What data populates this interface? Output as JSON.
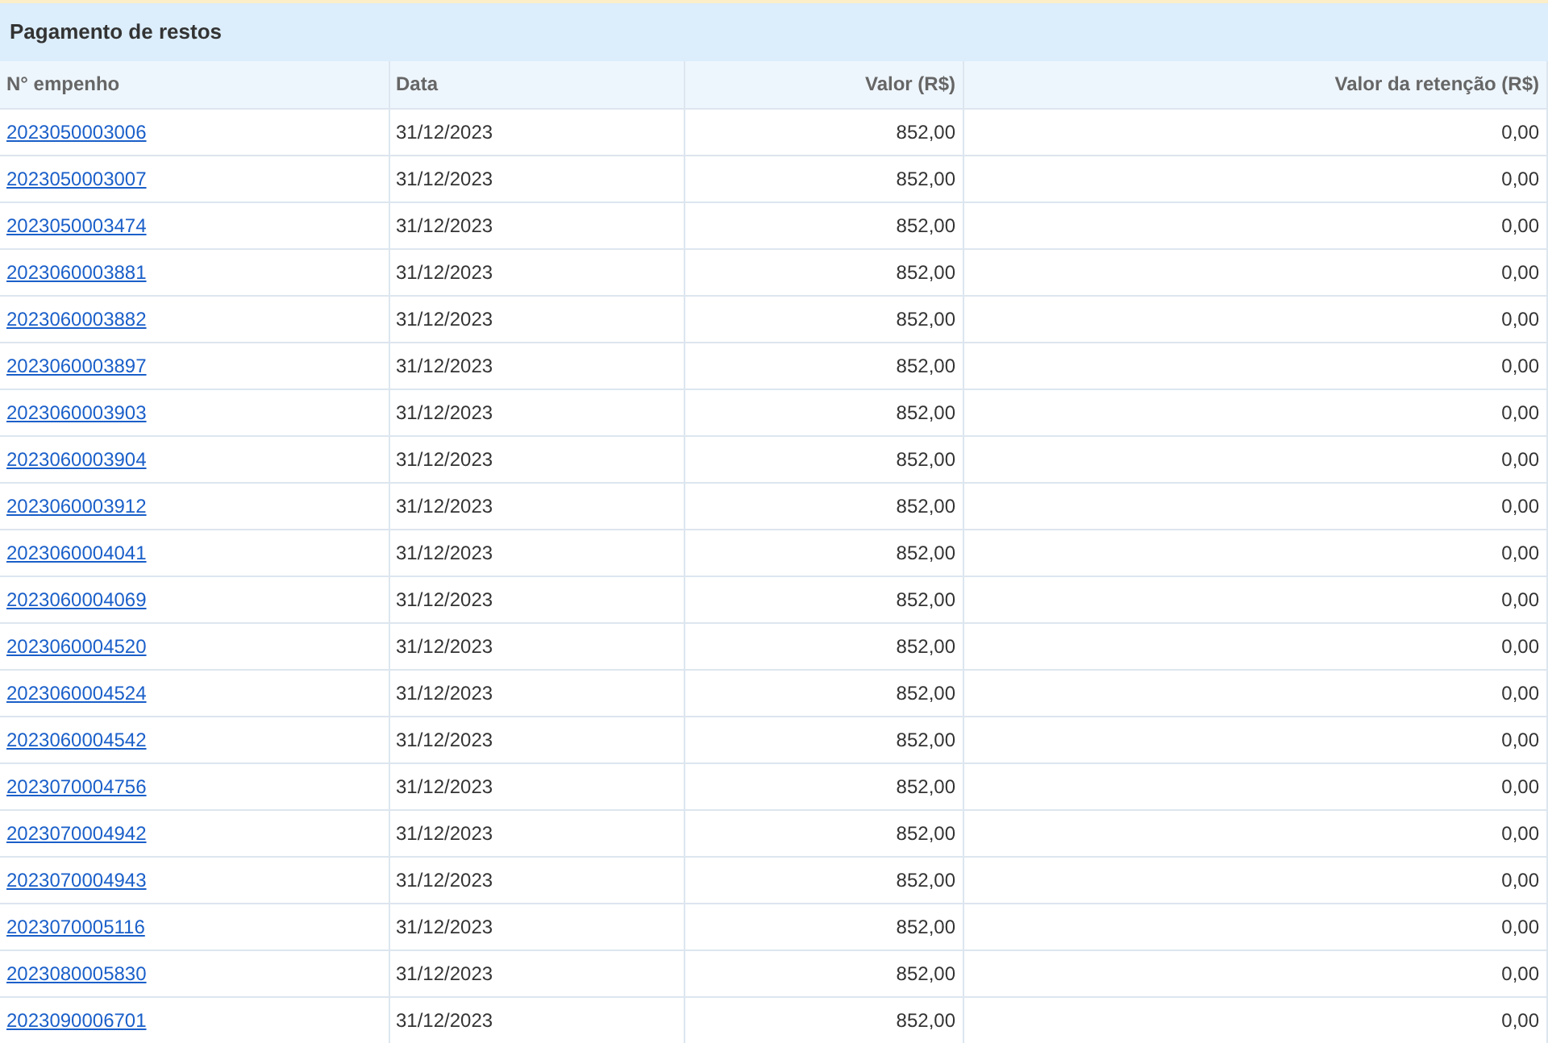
{
  "panel": {
    "title": "Pagamento de restos"
  },
  "table": {
    "columns": [
      "N° empenho",
      "Data",
      "Valor (R$)",
      "Valor da retenção (R$)"
    ],
    "rows": [
      [
        "2023050003006",
        "31/12/2023",
        "852,00",
        "0,00"
      ],
      [
        "2023050003007",
        "31/12/2023",
        "852,00",
        "0,00"
      ],
      [
        "2023050003474",
        "31/12/2023",
        "852,00",
        "0,00"
      ],
      [
        "2023060003881",
        "31/12/2023",
        "852,00",
        "0,00"
      ],
      [
        "2023060003882",
        "31/12/2023",
        "852,00",
        "0,00"
      ],
      [
        "2023060003897",
        "31/12/2023",
        "852,00",
        "0,00"
      ],
      [
        "2023060003903",
        "31/12/2023",
        "852,00",
        "0,00"
      ],
      [
        "2023060003904",
        "31/12/2023",
        "852,00",
        "0,00"
      ],
      [
        "2023060003912",
        "31/12/2023",
        "852,00",
        "0,00"
      ],
      [
        "2023060004041",
        "31/12/2023",
        "852,00",
        "0,00"
      ],
      [
        "2023060004069",
        "31/12/2023",
        "852,00",
        "0,00"
      ],
      [
        "2023060004520",
        "31/12/2023",
        "852,00",
        "0,00"
      ],
      [
        "2023060004524",
        "31/12/2023",
        "852,00",
        "0,00"
      ],
      [
        "2023060004542",
        "31/12/2023",
        "852,00",
        "0,00"
      ],
      [
        "2023070004756",
        "31/12/2023",
        "852,00",
        "0,00"
      ],
      [
        "2023070004942",
        "31/12/2023",
        "852,00",
        "0,00"
      ],
      [
        "2023070004943",
        "31/12/2023",
        "852,00",
        "0,00"
      ],
      [
        "2023070005116",
        "31/12/2023",
        "852,00",
        "0,00"
      ],
      [
        "2023080005830",
        "31/12/2023",
        "852,00",
        "0,00"
      ],
      [
        "2023090006701",
        "31/12/2023",
        "852,00",
        "0,00"
      ]
    ]
  }
}
